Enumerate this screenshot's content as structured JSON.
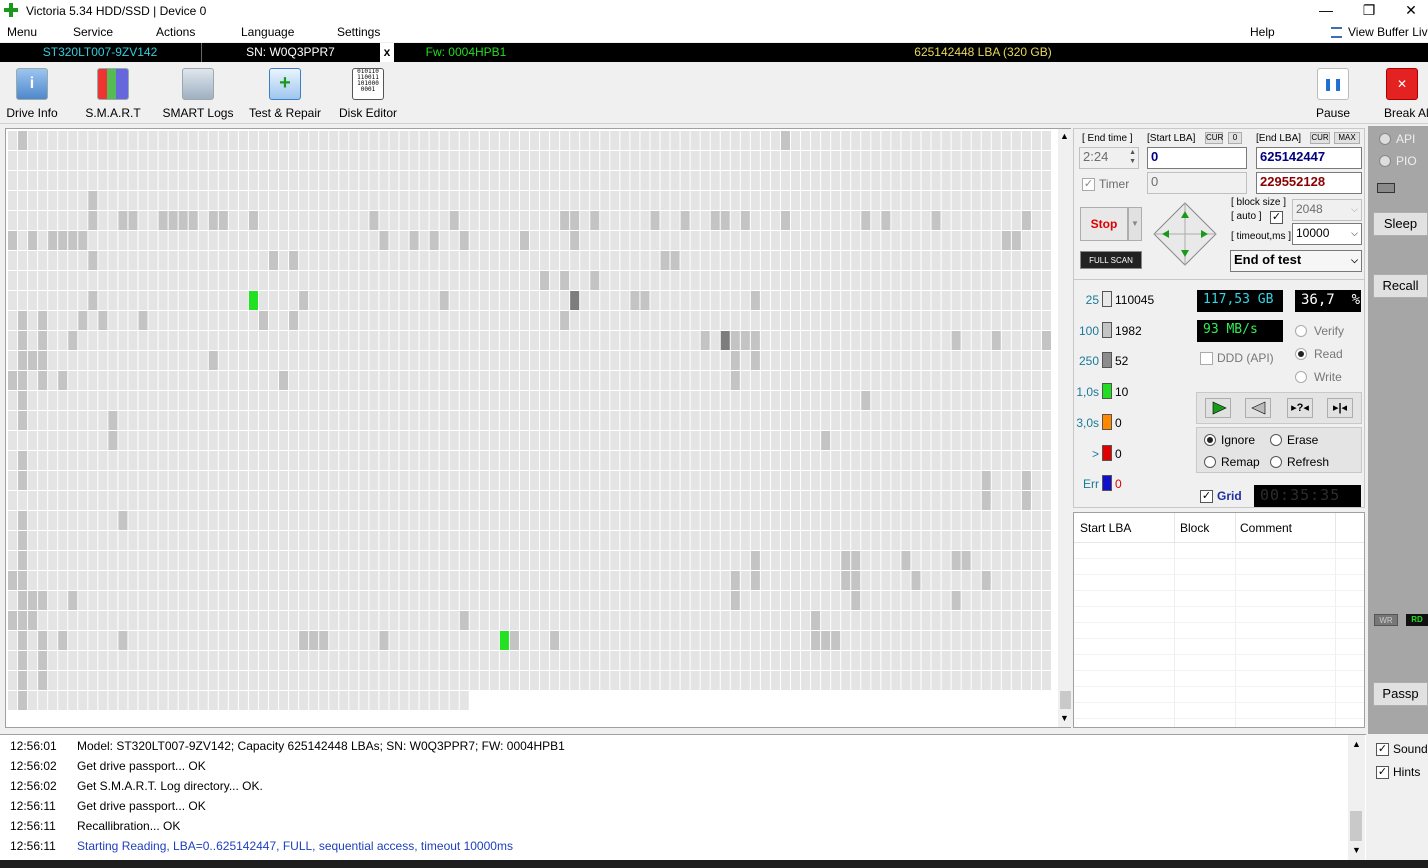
{
  "window": {
    "title": "Victoria 5.34 HDD/SSD | Device 0",
    "min": "—",
    "max": "❐",
    "close": "✕"
  },
  "menu": {
    "items": [
      "Menu",
      "Service",
      "Actions",
      "Language",
      "Settings"
    ],
    "help": "Help",
    "view_buffer": "View Buffer Live"
  },
  "device": {
    "model": "ST320LT007-9ZV142",
    "serial": "SN: W0Q3PPR7",
    "close": "x",
    "firmware": "Fw: 0004HPB1",
    "capacity": "625142448 LBA (320 GB)"
  },
  "toolbar": {
    "buttons": [
      {
        "label": "Drive Info",
        "icon": "drive-info-icon"
      },
      {
        "label": "S.M.A.R.T",
        "icon": "smart-icon"
      },
      {
        "label": "SMART Logs",
        "icon": "smart-logs-icon"
      },
      {
        "label": "Test & Repair",
        "icon": "test-repair-icon"
      },
      {
        "label": "Disk Editor",
        "icon": "disk-editor-icon"
      }
    ],
    "pause": "Pause",
    "break_all": "Break All"
  },
  "test": {
    "end_time_label": "[ End time ]",
    "start_lba_label": "[Start LBA]",
    "cur_label": "CUR",
    "zero_label": "0",
    "end_lba_label": "[End LBA]",
    "max_label": "MAX",
    "end_time": "2:24",
    "start_lba": "0",
    "end_lba": "625142447",
    "timer_label": "Timer",
    "timer_value": "0",
    "current_lba": "229552128",
    "stop": "Stop",
    "full_scan": "FULL SCAN",
    "block_size_label": "[ block size ]",
    "auto_label": "[ auto ]",
    "timeout_label": "[ timeout,ms ]",
    "block_size": "2048",
    "timeout": "10000",
    "end_action": "End of test"
  },
  "stats": {
    "rows": [
      {
        "label": "25",
        "count": "110045",
        "color": "#e8e8e8"
      },
      {
        "label": "100",
        "count": "1982",
        "color": "#c4c4c4"
      },
      {
        "label": "250",
        "count": "52",
        "color": "#8c8c8c"
      },
      {
        "label": "1,0s",
        "count": "10",
        "color": "#22dd22"
      },
      {
        "label": "3,0s",
        "count": "0",
        "color": "#ff8800"
      },
      {
        "label": ">",
        "count": "0",
        "color": "#e00000"
      },
      {
        "label": "Err",
        "count": "0",
        "color": "#1010cc"
      }
    ],
    "size_done": "117,53 GB",
    "percent": "36,7",
    "percent_unit": "%",
    "speed": "93 MB/s",
    "ddd": "DDD (API)",
    "modes": [
      "Verify",
      "Read",
      "Write"
    ],
    "repair": [
      "Ignore",
      "Erase",
      "Remap",
      "Refresh"
    ],
    "grid_label": "Grid",
    "elapsed": "00:35:35"
  },
  "defects_table": {
    "columns": [
      "Start LBA",
      "Block",
      "Comment"
    ]
  },
  "side": {
    "api": "API",
    "pio": "PIO",
    "sleep": "Sleep",
    "recall": "Recall",
    "wr": "WR",
    "rd": "RD",
    "passp": "Passp",
    "sound": "Sound",
    "hints": "Hints"
  },
  "log": [
    {
      "time": "12:56:01",
      "text": "Model: ST320LT007-9ZV142; Capacity 625142448 LBAs; SN: W0Q3PPR7; FW: 0004HPB1",
      "color": "#000000"
    },
    {
      "time": "12:56:02",
      "text": "Get drive passport... OK",
      "color": "#000000"
    },
    {
      "time": "12:56:02",
      "text": "Get S.M.A.R.T. Log directory... OK.",
      "color": "#000000"
    },
    {
      "time": "12:56:11",
      "text": "Get drive passport... OK",
      "color": "#000000"
    },
    {
      "time": "12:56:11",
      "text": "Recallibration... OK",
      "color": "#000000"
    },
    {
      "time": "12:56:11",
      "text": "Starting Reading, LBA=0..625142447, FULL, sequential access, timeout 10000ms",
      "color": "#1f3fbf"
    }
  ],
  "scan_grid": {
    "cols": 104,
    "rows": 29,
    "done_last_row": 46,
    "light": [
      [
        0,
        1
      ],
      [
        0,
        2
      ],
      [
        1,
        2
      ],
      [
        2,
        3
      ],
      [
        3,
        5
      ],
      [
        4,
        1
      ],
      [
        4,
        2
      ],
      [
        5,
        2
      ],
      [
        5,
        3
      ],
      [
        7,
        1
      ],
      [
        7,
        6
      ],
      [
        7,
        10
      ],
      [
        8,
        5
      ],
      [
        8,
        8
      ],
      [
        9,
        8
      ],
      [
        10,
        2
      ],
      [
        10,
        6
      ],
      [
        11,
        4
      ],
      [
        12,
        1
      ],
      [
        13,
        1
      ],
      [
        14,
        3
      ],
      [
        17,
        7
      ],
      [
        17,
        12
      ],
      [
        20,
        2
      ],
      [
        21,
        1
      ],
      [
        22,
        2
      ],
      [
        24,
        6
      ],
      [
        25,
        6
      ],
      [
        26,
        6
      ],
      [
        27,
        5
      ],
      [
        28,
        6
      ],
      [
        29,
        7
      ],
      [
        30,
        5
      ],
      [
        31,
        5
      ],
      [
        33,
        2
      ],
      [
        33,
        6
      ],
      [
        35,
        4
      ],
      [
        36,
        7
      ],
      [
        37,
        10
      ],
      [
        38,
        1
      ],
      [
        39,
        6
      ],
      [
        40,
        1
      ],
      [
        41,
        7
      ],
      [
        42,
        3
      ],
      [
        43,
        8
      ],
      [
        44,
        5
      ],
      [
        45,
        4
      ],
      [
        45,
        6
      ],
      [
        46,
        2
      ],
      [
        47,
        5
      ],
      [
        48,
        3
      ],
      [
        49,
        8
      ],
      [
        50,
        2
      ],
      [
        51,
        9
      ],
      [
        52,
        3
      ],
      [
        53,
        5
      ],
      [
        54,
        7
      ],
      [
        55,
        1
      ],
      [
        55,
        2
      ],
      [
        55,
        6
      ],
      [
        56,
        4
      ],
      [
        57,
        7
      ],
      [
        58,
        3
      ],
      [
        59,
        5
      ],
      [
        60,
        2
      ],
      [
        61,
        6
      ],
      [
        62,
        4
      ],
      [
        63,
        2
      ],
      [
        64,
        8
      ],
      [
        65,
        3
      ],
      [
        66,
        4
      ],
      [
        67,
        3
      ],
      [
        68,
        3
      ],
      [
        69,
        5
      ],
      [
        70,
        4
      ],
      [
        71,
        5
      ],
      [
        72,
        4
      ],
      [
        73,
        7
      ],
      [
        74,
        2
      ],
      [
        74,
        10
      ],
      [
        74,
        8
      ],
      [
        75,
        7
      ],
      [
        76,
        6
      ],
      [
        77,
        2
      ],
      [
        78,
        8
      ],
      [
        79,
        3
      ],
      [
        80,
        7
      ],
      [
        81,
        4
      ],
      [
        82,
        3
      ],
      [
        83,
        9
      ],
      [
        84,
        2
      ],
      [
        85,
        3
      ],
      [
        86,
        3
      ],
      [
        87,
        4
      ],
      [
        88,
        2
      ],
      [
        89,
        4
      ],
      [
        90,
        1
      ],
      [
        91,
        5
      ],
      [
        92,
        5
      ],
      [
        93,
        3
      ],
      [
        94,
        3
      ],
      [
        95,
        6
      ],
      [
        96,
        5
      ],
      [
        97,
        8
      ],
      [
        98,
        3
      ],
      [
        99,
        5
      ],
      [
        100,
        4
      ],
      [
        101,
        5
      ],
      [
        102,
        5
      ],
      [
        103,
        4
      ]
    ],
    "mid": [
      [
        0,
        1
      ],
      [
        5,
        0
      ],
      [
        5,
        1
      ],
      [
        5,
        5
      ],
      [
        5,
        6
      ],
      [
        7,
        7
      ],
      [
        7,
        12
      ],
      [
        7,
        8
      ],
      [
        8,
        2
      ],
      [
        9,
        7
      ],
      [
        10,
        3
      ],
      [
        10,
        5
      ],
      [
        11,
        0
      ],
      [
        13,
        0
      ],
      [
        14,
        1
      ],
      [
        14,
        8
      ],
      [
        14,
        7
      ],
      [
        14,
        9
      ],
      [
        16,
        0
      ],
      [
        18,
        0
      ],
      [
        19,
        5
      ],
      [
        19,
        6
      ],
      [
        20,
        2
      ],
      [
        20,
        21
      ],
      [
        20,
        22
      ],
      [
        20,
        23
      ],
      [
        24,
        0
      ],
      [
        24,
        1
      ],
      [
        26,
        0
      ],
      [
        27,
        0
      ],
      [
        28,
        1
      ],
      [
        28,
        2
      ],
      [
        29,
        1
      ],
      [
        29,
        2
      ],
      [
        30,
        1
      ],
      [
        30,
        2
      ],
      [
        31,
        1
      ],
      [
        31,
        2
      ],
      [
        32,
        1
      ],
      [
        32,
        2
      ],
      [
        33,
        1
      ],
      [
        34,
        1
      ],
      [
        35,
        1
      ],
      [
        36,
        1
      ],
      [
        37,
        1
      ],
      [
        38,
        1
      ],
      [
        39,
        0
      ],
      [
        40,
        0
      ],
      [
        41,
        0
      ],
      [
        42,
        0
      ],
      [
        43,
        0
      ],
      [
        44,
        0
      ],
      [
        45,
        0
      ],
      [
        46,
        0
      ],
      [
        47,
        0
      ],
      [
        48,
        0
      ],
      [
        49,
        0
      ],
      [
        50,
        0
      ],
      [
        51,
        0
      ],
      [
        52,
        0
      ],
      [
        53,
        0
      ],
      [
        54,
        0
      ],
      [
        55,
        0
      ],
      [
        56,
        0
      ],
      [
        57,
        0
      ],
      [
        58,
        0
      ],
      [
        59,
        0
      ],
      [
        60,
        0
      ],
      [
        61,
        0
      ],
      [
        62,
        0
      ],
      [
        63,
        0
      ],
      [
        64,
        0
      ],
      [
        65,
        0
      ],
      [
        66,
        0
      ],
      [
        67,
        0
      ],
      [
        68,
        0
      ],
      [
        69,
        0
      ],
      [
        70,
        0
      ],
      [
        71,
        0
      ],
      [
        72,
        0
      ],
      [
        73,
        0
      ],
      [
        74,
        0
      ],
      [
        75,
        0
      ],
      [
        76,
        0
      ],
      [
        77,
        0
      ],
      [
        78,
        0
      ],
      [
        79,
        0
      ],
      [
        80,
        0
      ],
      [
        81,
        0
      ],
      [
        82,
        0
      ],
      [
        83,
        0
      ],
      [
        84,
        0
      ],
      [
        85,
        0
      ],
      [
        86,
        0
      ],
      [
        87,
        0
      ],
      [
        88,
        0
      ],
      [
        89,
        0
      ],
      [
        90,
        0
      ],
      [
        91,
        0
      ],
      [
        92,
        0
      ],
      [
        93,
        0
      ],
      [
        94,
        0
      ],
      [
        95,
        0
      ],
      [
        96,
        0
      ],
      [
        97,
        0
      ],
      [
        98,
        0
      ],
      [
        99,
        0
      ],
      [
        100,
        0
      ],
      [
        101,
        0
      ],
      [
        102,
        0
      ],
      [
        103,
        0
      ]
    ],
    "gray_cells": [
      [
        1,
        0
      ],
      [
        1,
        9
      ],
      [
        1,
        10
      ],
      [
        1,
        11
      ],
      [
        1,
        12
      ],
      [
        1,
        13
      ],
      [
        1,
        14
      ],
      [
        1,
        16
      ],
      [
        1,
        17
      ],
      [
        1,
        19
      ],
      [
        1,
        20
      ],
      [
        1,
        21
      ],
      [
        1,
        22
      ],
      [
        1,
        23
      ],
      [
        1,
        24
      ],
      [
        1,
        25
      ],
      [
        1,
        26
      ],
      [
        1,
        27
      ],
      [
        1,
        28
      ],
      [
        0,
        5
      ],
      [
        0,
        12
      ],
      [
        0,
        22
      ],
      [
        0,
        24
      ],
      [
        2,
        5
      ],
      [
        2,
        11
      ],
      [
        2,
        23
      ],
      [
        3,
        23
      ],
      [
        4,
        5
      ],
      [
        5,
        5
      ],
      [
        6,
        5
      ],
      [
        7,
        5
      ],
      [
        2,
        24
      ],
      [
        3,
        9
      ],
      [
        3,
        10
      ],
      [
        3,
        11
      ],
      [
        3,
        12
      ],
      [
        3,
        25
      ],
      [
        3,
        26
      ],
      [
        3,
        27
      ],
      [
        5,
        12
      ],
      [
        5,
        25
      ],
      [
        6,
        10
      ],
      [
        6,
        23
      ],
      [
        7,
        9
      ],
      [
        8,
        8
      ],
      [
        8,
        3
      ],
      [
        8,
        4
      ],
      [
        8,
        6
      ],
      [
        9,
        9
      ],
      [
        10,
        14
      ],
      [
        10,
        15
      ],
      [
        11,
        4
      ],
      [
        11,
        19
      ],
      [
        11,
        25
      ],
      [
        12,
        4
      ],
      [
        13,
        9
      ],
      [
        15,
        4
      ],
      [
        16,
        4
      ],
      [
        17,
        4
      ],
      [
        18,
        4
      ],
      [
        20,
        4
      ],
      [
        20,
        11
      ],
      [
        21,
        4
      ],
      [
        24,
        4
      ],
      [
        25,
        9
      ],
      [
        26,
        6
      ],
      [
        27,
        12
      ],
      [
        28,
        6
      ],
      [
        28,
        9
      ],
      [
        29,
        8
      ],
      [
        29,
        25
      ],
      [
        30,
        25
      ],
      [
        31,
        25
      ],
      [
        36,
        4
      ],
      [
        37,
        5
      ],
      [
        37,
        25
      ],
      [
        40,
        5
      ],
      [
        42,
        5
      ],
      [
        43,
        8
      ],
      [
        44,
        4
      ],
      [
        45,
        5
      ],
      [
        45,
        24
      ],
      [
        49,
        25
      ],
      [
        50,
        25
      ],
      [
        51,
        5
      ],
      [
        53,
        7
      ],
      [
        54,
        25
      ],
      [
        55,
        7
      ],
      [
        55,
        9
      ],
      [
        55,
        4
      ],
      [
        56,
        4
      ],
      [
        56,
        5
      ],
      [
        56,
        8
      ],
      [
        58,
        4
      ],
      [
        58,
        7
      ],
      [
        62,
        8
      ],
      [
        63,
        8
      ],
      [
        64,
        4
      ],
      [
        65,
        6
      ],
      [
        66,
        6
      ],
      [
        67,
        4
      ],
      [
        69,
        10
      ],
      [
        70,
        4
      ],
      [
        71,
        4
      ],
      [
        72,
        10
      ],
      [
        72,
        11
      ],
      [
        72,
        12
      ],
      [
        72,
        22
      ],
      [
        72,
        23
      ],
      [
        73,
        4
      ],
      [
        73,
        10
      ],
      [
        74,
        8
      ],
      [
        74,
        10
      ],
      [
        74,
        11
      ],
      [
        74,
        21
      ],
      [
        74,
        22
      ],
      [
        77,
        0
      ],
      [
        77,
        4
      ],
      [
        80,
        24
      ],
      [
        80,
        25
      ],
      [
        81,
        15
      ],
      [
        81,
        25
      ],
      [
        82,
        25
      ],
      [
        83,
        21
      ],
      [
        83,
        22
      ],
      [
        84,
        21
      ],
      [
        84,
        22
      ],
      [
        84,
        23
      ],
      [
        85,
        4
      ],
      [
        85,
        13
      ],
      [
        87,
        4
      ],
      [
        89,
        21
      ],
      [
        90,
        22
      ],
      [
        92,
        4
      ],
      [
        94,
        10
      ],
      [
        94,
        21
      ],
      [
        94,
        23
      ],
      [
        95,
        21
      ],
      [
        97,
        17
      ],
      [
        97,
        18
      ],
      [
        97,
        22
      ],
      [
        98,
        10
      ],
      [
        99,
        5
      ],
      [
        100,
        5
      ],
      [
        101,
        4
      ],
      [
        101,
        17
      ],
      [
        101,
        18
      ],
      [
        103,
        10
      ]
    ],
    "dark_cells": [
      [
        56,
        8
      ],
      [
        71,
        10
      ]
    ],
    "green_cells": [
      [
        24,
        8
      ],
      [
        49,
        25
      ]
    ]
  }
}
